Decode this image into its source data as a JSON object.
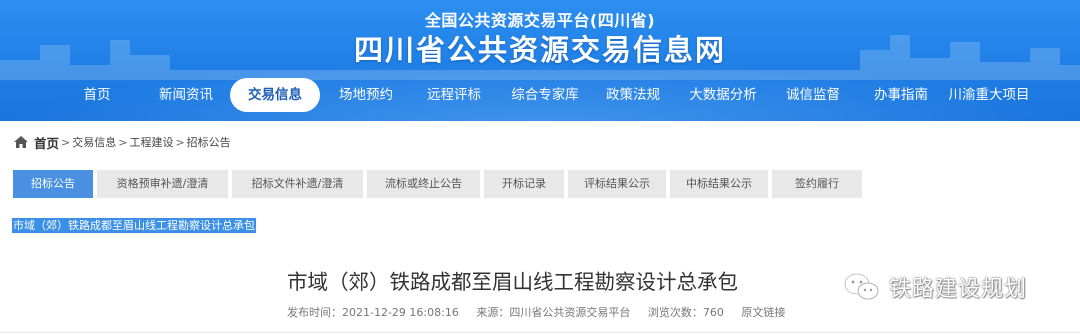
{
  "header": {
    "sub_title": "全国公共资源交易平台(四川省)",
    "main_title": "四川省公共资源交易信息网"
  },
  "nav": {
    "items": [
      "首页",
      "新闻资讯",
      "交易信息",
      "场地预约",
      "远程评标",
      "综合专家库",
      "政策法规",
      "大数据分析",
      "诚信监督",
      "办事指南",
      "川渝重大项目"
    ],
    "active": "交易信息"
  },
  "breadcrumb": {
    "home": "首页",
    "sep": ">",
    "items": [
      "交易信息",
      "工程建设",
      "招标公告"
    ]
  },
  "tabs": {
    "items": [
      "招标公告",
      "资格预审补遗/澄清",
      "招标文件补遗/澄清",
      "流标或终止公告",
      "开标记录",
      "评标结果公示",
      "中标结果公示",
      "签约履行"
    ],
    "active": "招标公告"
  },
  "selected_text": "市域（郊）铁路成都至眉山线工程勘察设计总承包",
  "article": {
    "title": "市域（郊）铁路成都至眉山线工程勘察设计总承包",
    "publish_label": "发布时间：",
    "publish_time": "2021-12-29 16:08:16",
    "source_label": "来源：",
    "source": "四川省公共资源交易平台",
    "views_label": "浏览次数：",
    "views": "760",
    "original_link": "原文链接"
  },
  "watermark": {
    "text": "铁路建设规划",
    "icon": "wechat-icon"
  },
  "colors": {
    "header_blue": "#1f7fe6",
    "active_nav_text": "#1d5fb8",
    "tab_active": "#4a90e2",
    "tab_inactive": "#e8e8e8",
    "selection": "#3b8fe6"
  }
}
